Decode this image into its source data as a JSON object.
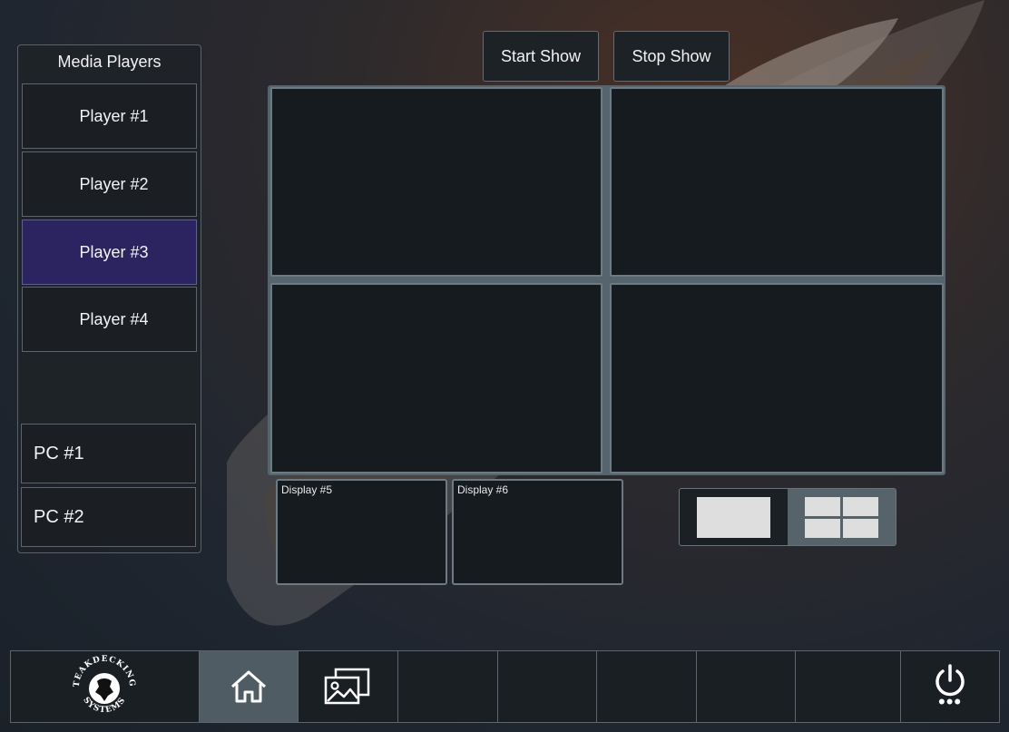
{
  "sidebar": {
    "title": "Media Players",
    "players": [
      {
        "label": "Player #1",
        "active": false
      },
      {
        "label": "Player #2",
        "active": false
      },
      {
        "label": "Player #3",
        "active": true
      },
      {
        "label": "Player #4",
        "active": false
      }
    ],
    "pcs": [
      {
        "label": "PC #1"
      },
      {
        "label": "PC #2"
      }
    ]
  },
  "controls": {
    "start_show": "Start Show",
    "stop_show": "Stop Show"
  },
  "displays": {
    "small": [
      {
        "label": "Display #5"
      },
      {
        "label": "Display #6"
      }
    ]
  },
  "layout_toggle": {
    "options": [
      "single-layout-icon",
      "quad-layout-icon"
    ],
    "selected": "quad-layout-icon"
  },
  "bottom_bar": {
    "logo": {
      "text_top": "TEAKDECKING",
      "text_bottom": "SYSTEMS"
    },
    "icons": [
      "home-icon",
      "media-gallery-icon",
      "power-icon"
    ],
    "active": "home-icon",
    "power_dots": "•••"
  },
  "colors": {
    "active_player": "#2b2460",
    "active_tab": "#4f5c64",
    "screen_border": "#6c7a83"
  }
}
